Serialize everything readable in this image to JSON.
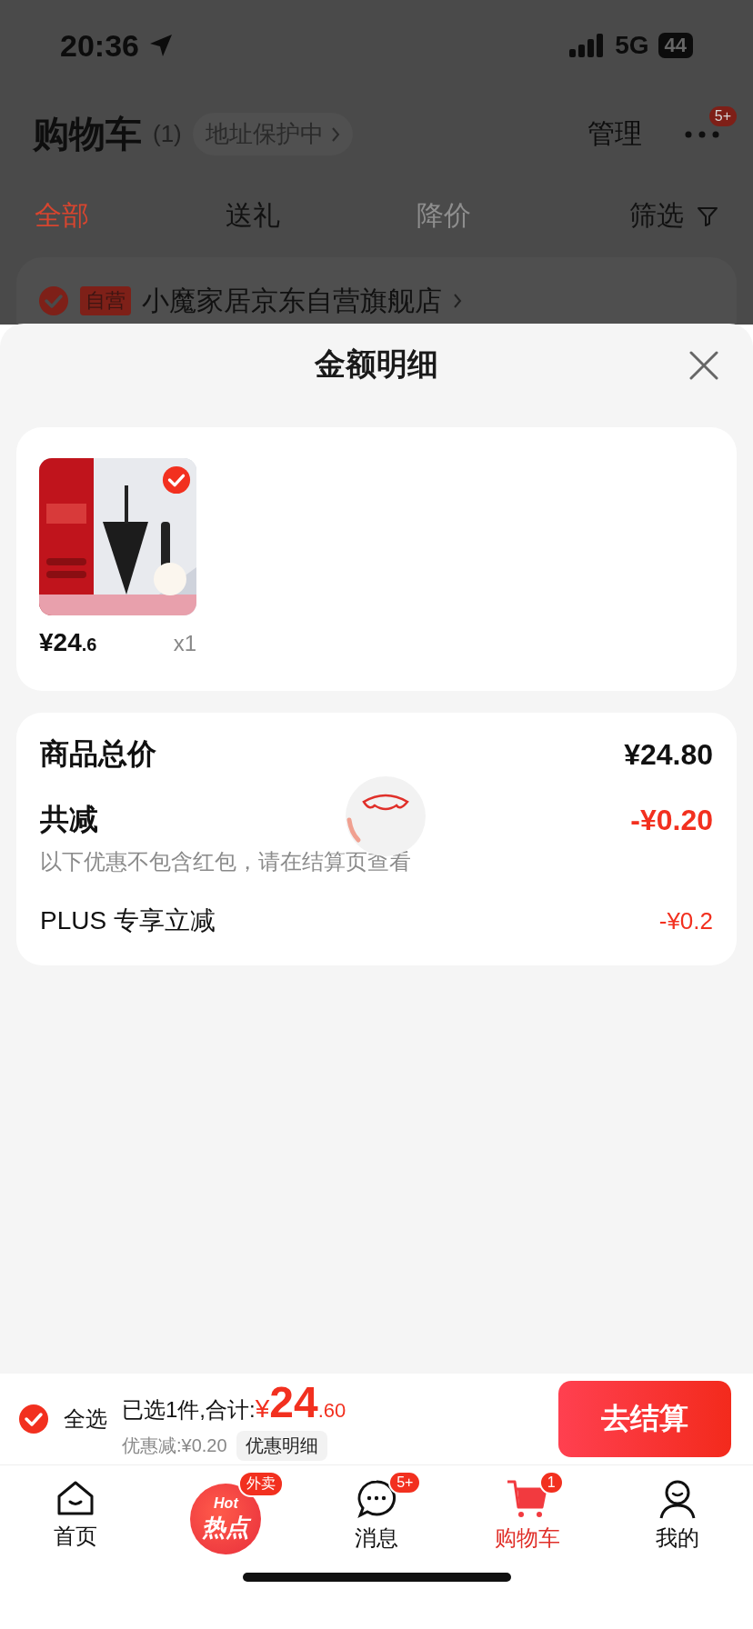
{
  "status_bar": {
    "time": "20:36",
    "network": "5G",
    "battery": "44"
  },
  "header": {
    "title": "购物车",
    "count": "(1)",
    "address_badge": "地址保护中",
    "manage": "管理",
    "more_badge": "5+"
  },
  "tabs": [
    {
      "label": "全部",
      "selected": true,
      "disabled": false
    },
    {
      "label": "送礼",
      "selected": false,
      "disabled": false
    },
    {
      "label": "降价",
      "selected": false,
      "disabled": true
    }
  ],
  "filter": "筛选",
  "store": {
    "checked": true,
    "tag": "自营",
    "name": "小魔家居京东自营旗舰店"
  },
  "sheet": {
    "title": "金额明细",
    "products": [
      {
        "kind": "picture",
        "checked": true,
        "price_main": "¥24",
        "price_decimal": ".6",
        "quantity": "x1"
      }
    ],
    "summary": [
      {
        "kind": "total",
        "label": "商品总价",
        "value": "¥24.80"
      },
      {
        "kind": "discount",
        "label": "共减",
        "value": "-¥0.20",
        "note": "以下优惠不包含红包，请在结算页查看"
      },
      {
        "kind": "item",
        "label": "PLUS 专享立减",
        "value": "-¥0.2"
      }
    ]
  },
  "checkout": {
    "select_all": {
      "checked": true,
      "label": "全选"
    },
    "summary_prefix": "已选1件,合计:",
    "currency": "¥",
    "amount_main": "24",
    "amount_decimal": ".60",
    "discount": "优惠减:¥0.20",
    "detail_button": "优惠明细",
    "button": "去结算"
  },
  "nav": [
    {
      "kind": "home",
      "label": "首页",
      "selected": false
    },
    {
      "kind": "promo",
      "badge": "外卖",
      "logo_top": "Hot",
      "logo_main": "热点"
    },
    {
      "kind": "message",
      "label": "消息",
      "badge": "5+",
      "selected": false
    },
    {
      "kind": "cart",
      "label": "购物车",
      "badge": "1",
      "selected": true
    },
    {
      "kind": "profile",
      "label": "我的",
      "selected": false
    }
  ]
}
